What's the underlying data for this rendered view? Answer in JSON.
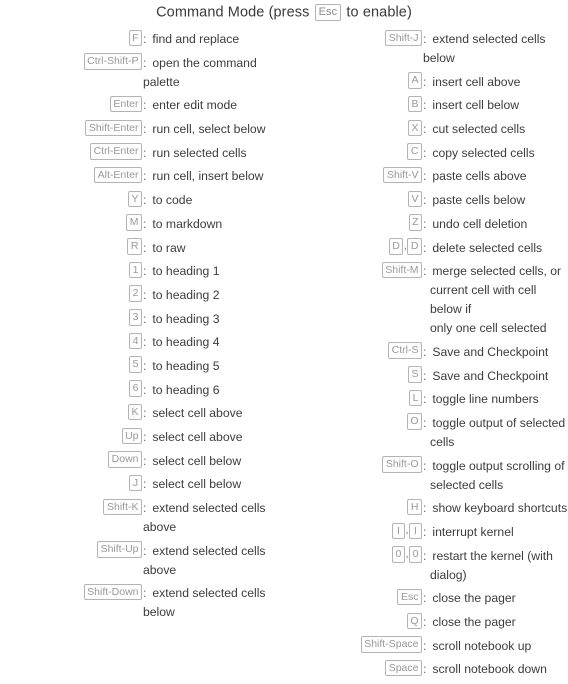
{
  "title": {
    "prefix": "Command Mode (press",
    "key": "Esc",
    "suffix": "to enable)"
  },
  "columns": [
    {
      "name": "left-column",
      "shortcuts": [
        {
          "keys": [
            "F"
          ],
          "desc": [
            "find and replace"
          ]
        },
        {
          "keys": [
            "Ctrl-Shift-P"
          ],
          "desc": [
            "open the command palette"
          ]
        },
        {
          "keys": [
            "Enter"
          ],
          "desc": [
            "enter edit mode"
          ]
        },
        {
          "keys": [
            "Shift-Enter"
          ],
          "desc": [
            "run cell, select below"
          ]
        },
        {
          "keys": [
            "Ctrl-Enter"
          ],
          "desc": [
            "run selected cells"
          ]
        },
        {
          "keys": [
            "Alt-Enter"
          ],
          "desc": [
            "run cell, insert below"
          ]
        },
        {
          "keys": [
            "Y"
          ],
          "desc": [
            "to code"
          ]
        },
        {
          "keys": [
            "M"
          ],
          "desc": [
            "to markdown"
          ]
        },
        {
          "keys": [
            "R"
          ],
          "desc": [
            "to raw"
          ]
        },
        {
          "keys": [
            "1"
          ],
          "desc": [
            "to heading 1"
          ]
        },
        {
          "keys": [
            "2"
          ],
          "desc": [
            "to heading 2"
          ]
        },
        {
          "keys": [
            "3"
          ],
          "desc": [
            "to heading 3"
          ]
        },
        {
          "keys": [
            "4"
          ],
          "desc": [
            "to heading 4"
          ]
        },
        {
          "keys": [
            "5"
          ],
          "desc": [
            "to heading 5"
          ]
        },
        {
          "keys": [
            "6"
          ],
          "desc": [
            "to heading 6"
          ]
        },
        {
          "keys": [
            "K"
          ],
          "desc": [
            "select cell above"
          ]
        },
        {
          "keys": [
            "Up"
          ],
          "desc": [
            "select cell above"
          ]
        },
        {
          "keys": [
            "Down"
          ],
          "desc": [
            "select cell below"
          ]
        },
        {
          "keys": [
            "J"
          ],
          "desc": [
            "select cell below"
          ]
        },
        {
          "keys": [
            "Shift-K"
          ],
          "desc": [
            "extend selected cells above"
          ]
        },
        {
          "keys": [
            "Shift-Up"
          ],
          "desc": [
            "extend selected cells above"
          ]
        },
        {
          "keys": [
            "Shift-Down"
          ],
          "desc": [
            "extend selected cells below"
          ]
        }
      ]
    },
    {
      "name": "right-column",
      "shortcuts": [
        {
          "keys": [
            "Shift-J"
          ],
          "desc": [
            "extend selected cells below"
          ]
        },
        {
          "keys": [
            "A"
          ],
          "desc": [
            "insert cell above"
          ]
        },
        {
          "keys": [
            "B"
          ],
          "desc": [
            "insert cell below"
          ]
        },
        {
          "keys": [
            "X"
          ],
          "desc": [
            "cut selected cells"
          ]
        },
        {
          "keys": [
            "C"
          ],
          "desc": [
            "copy selected cells"
          ]
        },
        {
          "keys": [
            "Shift-V"
          ],
          "desc": [
            "paste cells above"
          ]
        },
        {
          "keys": [
            "V"
          ],
          "desc": [
            "paste cells below"
          ]
        },
        {
          "keys": [
            "Z"
          ],
          "desc": [
            "undo cell deletion"
          ]
        },
        {
          "keys": [
            "D",
            "D"
          ],
          "desc": [
            "delete selected cells"
          ]
        },
        {
          "keys": [
            "Shift-M"
          ],
          "desc": [
            "merge selected cells, or",
            "current cell with cell below if",
            "only one cell selected"
          ]
        },
        {
          "keys": [
            "Ctrl-S"
          ],
          "desc": [
            "Save and Checkpoint"
          ]
        },
        {
          "keys": [
            "S"
          ],
          "desc": [
            "Save and Checkpoint"
          ]
        },
        {
          "keys": [
            "L"
          ],
          "desc": [
            "toggle line numbers"
          ]
        },
        {
          "keys": [
            "O"
          ],
          "desc": [
            "toggle output of selected",
            "cells"
          ]
        },
        {
          "keys": [
            "Shift-O"
          ],
          "desc": [
            "toggle output scrolling of",
            "selected cells"
          ]
        },
        {
          "keys": [
            "H"
          ],
          "desc": [
            "show keyboard shortcuts"
          ]
        },
        {
          "keys": [
            "I",
            "I"
          ],
          "desc": [
            "interrupt kernel"
          ]
        },
        {
          "keys": [
            "0",
            "0"
          ],
          "desc": [
            "restart the kernel (with",
            "dialog)"
          ]
        },
        {
          "keys": [
            "Esc"
          ],
          "desc": [
            "close the pager"
          ]
        },
        {
          "keys": [
            "Q"
          ],
          "desc": [
            "close the pager"
          ]
        },
        {
          "keys": [
            "Shift-Space"
          ],
          "desc": [
            "scroll notebook up"
          ]
        },
        {
          "keys": [
            "Space"
          ],
          "desc": [
            "scroll notebook down"
          ]
        }
      ]
    }
  ]
}
